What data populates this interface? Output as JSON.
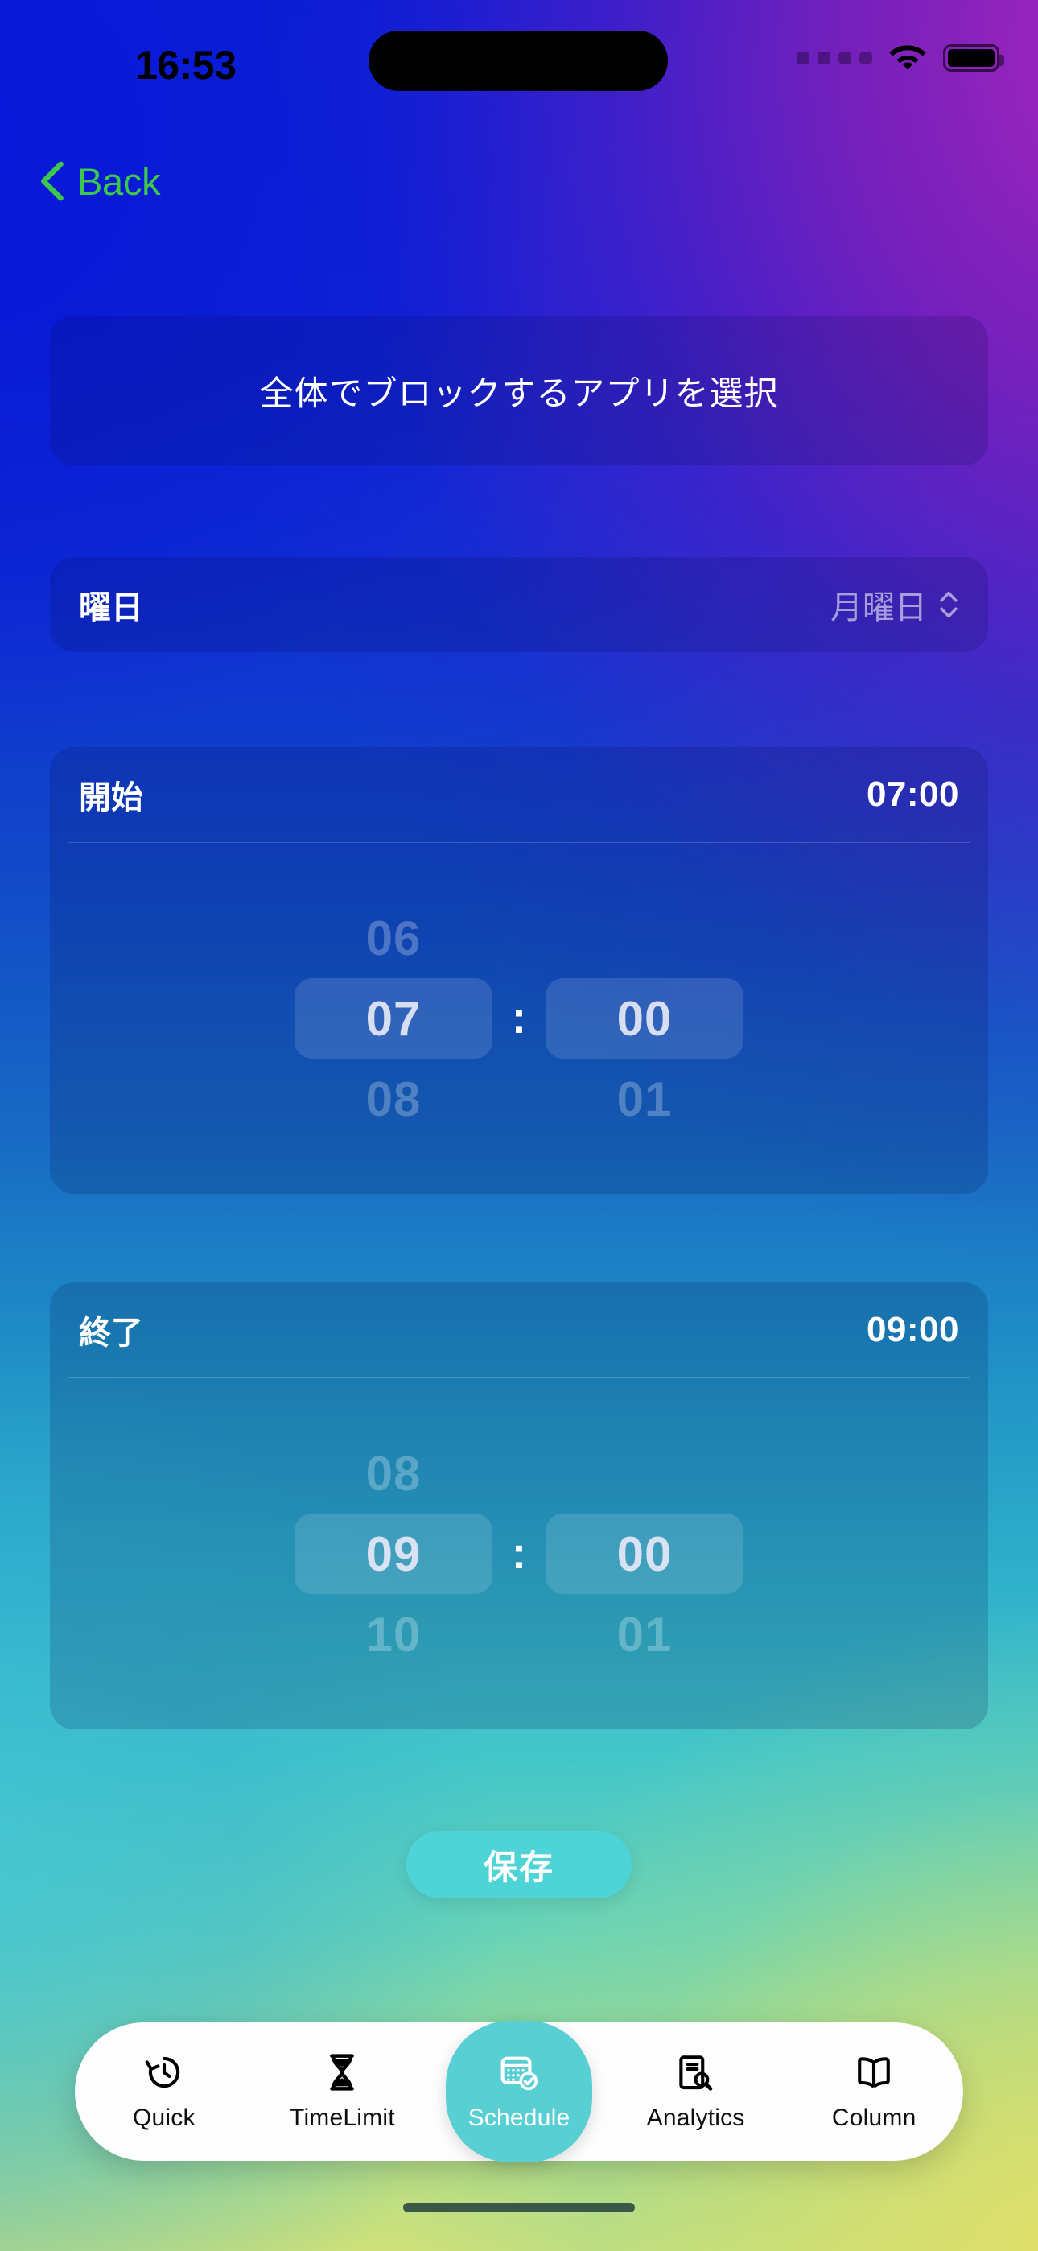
{
  "status_bar": {
    "time": "16:53",
    "signal_icon": "signal-dots-icon",
    "wifi_icon": "wifi-icon",
    "battery_icon": "battery-full-icon"
  },
  "nav": {
    "back_label": "Back",
    "back_icon": "chevron-left-icon",
    "back_color": "#3cc84c"
  },
  "select_apps": {
    "title": "全体でブロックするアプリを選択"
  },
  "weekday": {
    "label": "曜日",
    "value": "月曜日",
    "picker_icon": "chevron-up-down-icon"
  },
  "start": {
    "label": "開始",
    "value": "07:00",
    "hour": {
      "prev": "06",
      "selected": "07",
      "next": "08"
    },
    "minute": {
      "prev": "",
      "selected": "00",
      "next": "01"
    },
    "separator": ":"
  },
  "end": {
    "label": "終了",
    "value": "09:00",
    "hour": {
      "prev": "08",
      "selected": "09",
      "next": "10"
    },
    "minute": {
      "prev": "",
      "selected": "00",
      "next": "01"
    },
    "separator": ":"
  },
  "save": {
    "label": "保存",
    "color": "#4ed3d6"
  },
  "tabbar": {
    "active_color": "#58cfd2",
    "items": [
      {
        "label": "Quick",
        "icon": "clock-arrow-circlepath-icon",
        "active": false
      },
      {
        "label": "TimeLimit",
        "icon": "hourglass-icon",
        "active": false
      },
      {
        "label": "Schedule",
        "icon": "calendar-checkmark-icon",
        "active": true
      },
      {
        "label": "Analytics",
        "icon": "document-magnifier-icon",
        "active": false
      },
      {
        "label": "Column",
        "icon": "open-book-icon",
        "active": false
      }
    ]
  }
}
